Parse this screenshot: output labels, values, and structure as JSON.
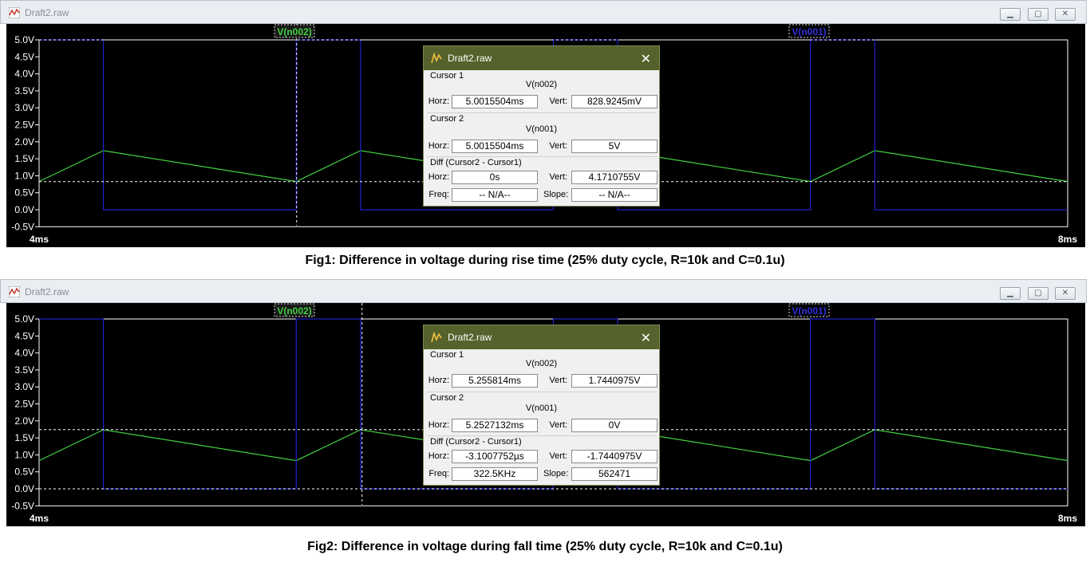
{
  "windows": [
    {
      "title": "Draft2.raw",
      "caption": "Fig1: Difference in voltage during rise time (25% duty cycle, R=10k and C=0.1u)",
      "trace_labels": {
        "green": "V(n002)",
        "blue": "V(n001)"
      },
      "x_ticks": {
        "start": "4ms",
        "end": "8ms"
      },
      "y_ticks": [
        "5.0V",
        "4.5V",
        "4.0V",
        "3.5V",
        "3.0V",
        "2.5V",
        "2.0V",
        "1.5V",
        "1.0V",
        "0.5V",
        "0.0V",
        "-0.5V"
      ],
      "cursor_dialog": {
        "title": "Draft2.raw",
        "close": "✕",
        "cursor1": {
          "label": "Cursor 1",
          "trace": "V(n002)",
          "horz_label": "Horz:",
          "horz": "5.0015504ms",
          "vert_label": "Vert:",
          "vert": "828.9245mV"
        },
        "cursor2": {
          "label": "Cursor 2",
          "trace": "V(n001)",
          "horz_label": "Horz:",
          "horz": "5.0015504ms",
          "vert_label": "Vert:",
          "vert": "5V"
        },
        "diff": {
          "label": "Diff (Cursor2 - Cursor1)",
          "horz_label": "Horz:",
          "horz": "0s",
          "vert_label": "Vert:",
          "vert": "4.1710755V",
          "freq_label": "Freq:",
          "freq": "-- N/A--",
          "slope_label": "Slope:",
          "slope": "-- N/A--"
        }
      }
    },
    {
      "title": "Draft2.raw",
      "caption": "Fig2: Difference in voltage during fall time (25% duty cycle, R=10k and C=0.1u)",
      "trace_labels": {
        "green": "V(n002)",
        "blue": "V(n001)"
      },
      "x_ticks": {
        "start": "4ms",
        "end": "8ms"
      },
      "y_ticks": [
        "5.0V",
        "4.5V",
        "4.0V",
        "3.5V",
        "3.0V",
        "2.5V",
        "2.0V",
        "1.5V",
        "1.0V",
        "0.5V",
        "0.0V",
        "-0.5V"
      ],
      "cursor_dialog": {
        "title": "Draft2.raw",
        "close": "✕",
        "cursor1": {
          "label": "Cursor 1",
          "trace": "V(n002)",
          "horz_label": "Horz:",
          "horz": "5.255814ms",
          "vert_label": "Vert:",
          "vert": "1.7440975V"
        },
        "cursor2": {
          "label": "Cursor 2",
          "trace": "V(n001)",
          "horz_label": "Horz:",
          "horz": "5.2527132ms",
          "vert_label": "Vert:",
          "vert": "0V"
        },
        "diff": {
          "label": "Diff (Cursor2 - Cursor1)",
          "horz_label": "Horz:",
          "horz": "-3.1007752µs",
          "vert_label": "Vert:",
          "vert": "-1.7440975V",
          "freq_label": "Freq:",
          "freq": "322.5KHz",
          "slope_label": "Slope:",
          "slope": "562471"
        }
      }
    }
  ],
  "chart_data": [
    {
      "type": "line",
      "xlim": [
        4,
        8
      ],
      "ylim": [
        -0.5,
        5.0
      ],
      "series": [
        {
          "name": "V(n002)",
          "color": "#40d040",
          "x": [
            4.0,
            4.25,
            5.0,
            5.25,
            6.0,
            6.25,
            7.0,
            7.25,
            8.0
          ],
          "y": [
            0.83,
            1.74,
            0.83,
            1.74,
            0.83,
            1.74,
            0.83,
            1.74,
            0.83
          ]
        },
        {
          "name": "V(n001)",
          "color": "#2020cc",
          "x": [
            4.0,
            4.25,
            4.25,
            5.0,
            5.0,
            5.25,
            5.25,
            6.0,
            6.0,
            6.25,
            6.25,
            7.0,
            7.0,
            7.25,
            7.25,
            8.0
          ],
          "y": [
            5,
            5,
            0,
            0,
            5,
            5,
            0,
            0,
            5,
            5,
            0,
            0,
            5,
            5,
            0,
            0
          ]
        }
      ],
      "cursors": {
        "vertical_x": 5.0015504,
        "horizontal_y": [
          0.8289245,
          5.0
        ]
      }
    },
    {
      "type": "line",
      "xlim": [
        4,
        8
      ],
      "ylim": [
        -0.5,
        5.0
      ],
      "series": [
        {
          "name": "V(n002)",
          "color": "#40d040",
          "x": [
            4.0,
            4.25,
            5.0,
            5.25,
            6.0,
            6.25,
            7.0,
            7.25,
            8.0
          ],
          "y": [
            0.83,
            1.74,
            0.83,
            1.74,
            0.83,
            1.74,
            0.83,
            1.74,
            0.83
          ]
        },
        {
          "name": "V(n001)",
          "color": "#2020cc",
          "x": [
            4.0,
            4.25,
            4.25,
            5.0,
            5.0,
            5.25,
            5.25,
            6.0,
            6.0,
            6.25,
            6.25,
            7.0,
            7.0,
            7.25,
            7.25,
            8.0
          ],
          "y": [
            5,
            5,
            0,
            0,
            5,
            5,
            0,
            0,
            5,
            5,
            0,
            0,
            5,
            5,
            0,
            0
          ]
        }
      ],
      "cursors": {
        "vertical_x": 5.255814,
        "horizontal_y": [
          1.7440975,
          0.0
        ]
      }
    }
  ]
}
